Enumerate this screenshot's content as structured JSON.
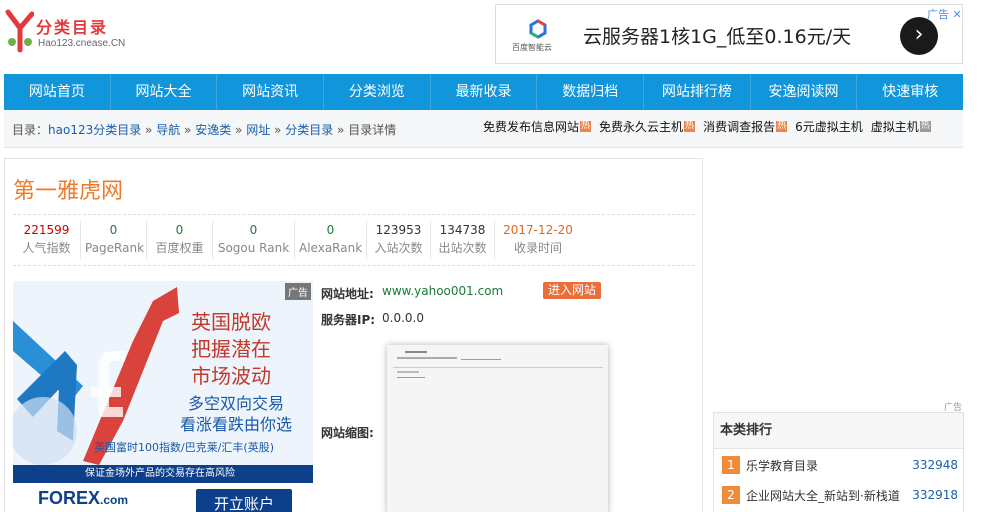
{
  "header": {
    "logo_name": "分类目录",
    "logo_url": "Hao123.cnease.CN"
  },
  "top_ad": {
    "logo_text": "百度智能云",
    "text": "云服务器1核1G_低至0.16元/天",
    "mark": "广告",
    "arrow": "›",
    "close": "✕"
  },
  "nav": {
    "items": [
      "网站首页",
      "网站大全",
      "网站资讯",
      "分类浏览",
      "最新收录",
      "数据归档",
      "网站排行榜",
      "安逸阅读网",
      "快速审核"
    ]
  },
  "breadcrumb": {
    "prefix": "目录：",
    "items": [
      "hao123分类目录",
      "导航",
      "安逸类",
      "网址",
      "分类目录"
    ],
    "sep": " » ",
    "current": "目录详情"
  },
  "promo": {
    "items": [
      "免费发布信息网站",
      "免费永久云主机",
      "消费调查报告",
      "6元虚拟主机",
      "虚拟主机"
    ],
    "hot": "热"
  },
  "site": {
    "title": "第一雅虎网",
    "stats": [
      {
        "value": "221599",
        "label": "人气指数",
        "color": "#cc0000"
      },
      {
        "value": "0",
        "label": "PageRank",
        "color": "#1b7a36"
      },
      {
        "value": "0",
        "label": "百度权重",
        "color": "#1b7a36"
      },
      {
        "value": "0",
        "label": "Sogou Rank",
        "color": "#1b7a36"
      },
      {
        "value": "0",
        "label": "AlexaRank",
        "color": "#1b7a36"
      },
      {
        "value": "123953",
        "label": "入站次数",
        "color": "#333333"
      },
      {
        "value": "134738",
        "label": "出站次数",
        "color": "#333333"
      },
      {
        "value": "2017-12-20",
        "label": "收录时间",
        "color": "#e06a1b"
      }
    ],
    "url_label": "网站地址:",
    "url": "www.yahoo001.com",
    "visit": "进入网站",
    "ip_label": "服务器IP:",
    "ip": "0.0.0.0",
    "thumb_label": "网站缩图:"
  },
  "forex_ad": {
    "adtag": "广告",
    "headline": [
      "英国脱欧",
      "把握潜在",
      "市场波动"
    ],
    "sub": [
      "多空双向交易",
      "看涨看跌由你选"
    ],
    "stocks": "英国富时100指数/巴克莱/汇丰(英股)",
    "risk": "保证金场外产品的交易存在高风险",
    "brand": "FOREX",
    "brand_suffix": ".com",
    "open": "开立账户"
  },
  "ranking": {
    "mark": "广告",
    "title": "本类排行",
    "items": [
      {
        "rank": "1",
        "name": "乐学教育目录",
        "count": "332948"
      },
      {
        "rank": "2",
        "name": "企业网站大全_新站到·新栈道",
        "count": "332918"
      }
    ]
  }
}
